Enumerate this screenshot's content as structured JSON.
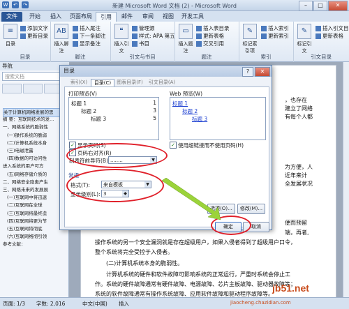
{
  "window": {
    "title": "新建 Microsoft Word 文档 (2) - Microsoft Word",
    "min": "–",
    "max": "□",
    "close": "✕"
  },
  "quick_access": [
    "W",
    "↶",
    "↷"
  ],
  "tabs": [
    "文件",
    "开始",
    "插入",
    "页面布局",
    "引用",
    "邮件",
    "审阅",
    "视图",
    "开发工具"
  ],
  "ribbon": {
    "groups": [
      "目录",
      "脚注",
      "引文与书目",
      "题注",
      "索引",
      "引文目录"
    ],
    "big_buttons": [
      "目录",
      "插入脚注",
      "插入引文",
      "插入题注",
      "标记索引项",
      "标记引文"
    ],
    "small_buttons": [
      "添加文字",
      "更新目录",
      "插入尾注",
      "下一条脚注",
      "显示备注",
      "管理源",
      "样式: APA 第五",
      "书目",
      "插入表目录",
      "更新表格",
      "交叉引用",
      "插入索引",
      "更新索引",
      "插入引文目录",
      "更新表格"
    ]
  },
  "nav": {
    "title": "导航",
    "search_placeholder": "搜索文档",
    "items": [
      "关于计算机网络发展的思",
      "摘 要：互联网技术的发...",
      "一、网络系统的脆弱性",
      "(一)操作系统的脆弱",
      "(二)计算机系统本身",
      "(三)电磁泄露",
      "(四)数据的可访问性",
      "进入系统的用户可方",
      "(五)网络存储介质的",
      "二、网络安全隐患产生",
      "三、网络未来的发展展",
      "(一)互联网中将迅速",
      "(二)互联网在全球",
      "(三)互联网将最终造",
      "(四)互联网将更为节",
      "(五)互联网将彻底",
      "(六)互联网络彻引领",
      "参考文献："
    ]
  },
  "doc_lines": [
    "，也存在",
    "建立了网络",
    "有每个人都",
    "为方便，人",
    "近年来计",
    "全发展状况",
    "便而预留",
    "端，再者,",
    "操作系统的另一个安全漏洞就是存在超级用户，如果入侵者得到了超级用户口令，",
    "整个系统将完全受控于入侵者。",
    "(二)计算机系统本身的脆弱性。",
    "计算机系统的硬件和软件故障可影响系统的正常运行，严重时系统会停止工",
    "作。系统的硬件故障通常有硬件故障、电源故障、芯片主板故障、驱动器故障等；",
    "系统的软件故障通常有操作系统故障、应用软件故障和驱动程序故障等。"
  ],
  "status": {
    "page": "页面: 1/3",
    "words": "字数: 2,016",
    "language": "中文(中国)",
    "mode": "插入"
  },
  "dialog": {
    "title": "目录",
    "help": "?",
    "close": "✕",
    "tabs": [
      "索引(X)",
      "目录(C)",
      "图表目录(F)",
      "引文目录(A)"
    ],
    "print_preview_label": "打印预览(V)",
    "web_preview_label": "Web 预览(W)",
    "print_preview": [
      {
        "text": "标题 1",
        "page": "1"
      },
      {
        "text": "标题 2",
        "page": "3"
      },
      {
        "text": "标题 3",
        "page": "5"
      }
    ],
    "web_preview": [
      "标题 1",
      "标题 2",
      "标题 3"
    ],
    "show_page_numbers": "显示页码(S)",
    "right_align": "页码右对齐(R)",
    "tab_leader_label": "制表符前导符(B):",
    "tab_leader_value": "........",
    "use_hyperlinks": "使用超链接而不使用页码(H)",
    "general": "常规",
    "format_label": "格式(T):",
    "format_value": "来自模板",
    "levels_label": "显示级别(L):",
    "levels_value": "3",
    "options_button": "选项(O)...",
    "modify_button": "修改(M)...",
    "ok_button": "确定",
    "cancel_button": "取消"
  },
  "watermark": {
    "site": "jb51.net",
    "sub": "jiaocheng.chazidian.com"
  }
}
